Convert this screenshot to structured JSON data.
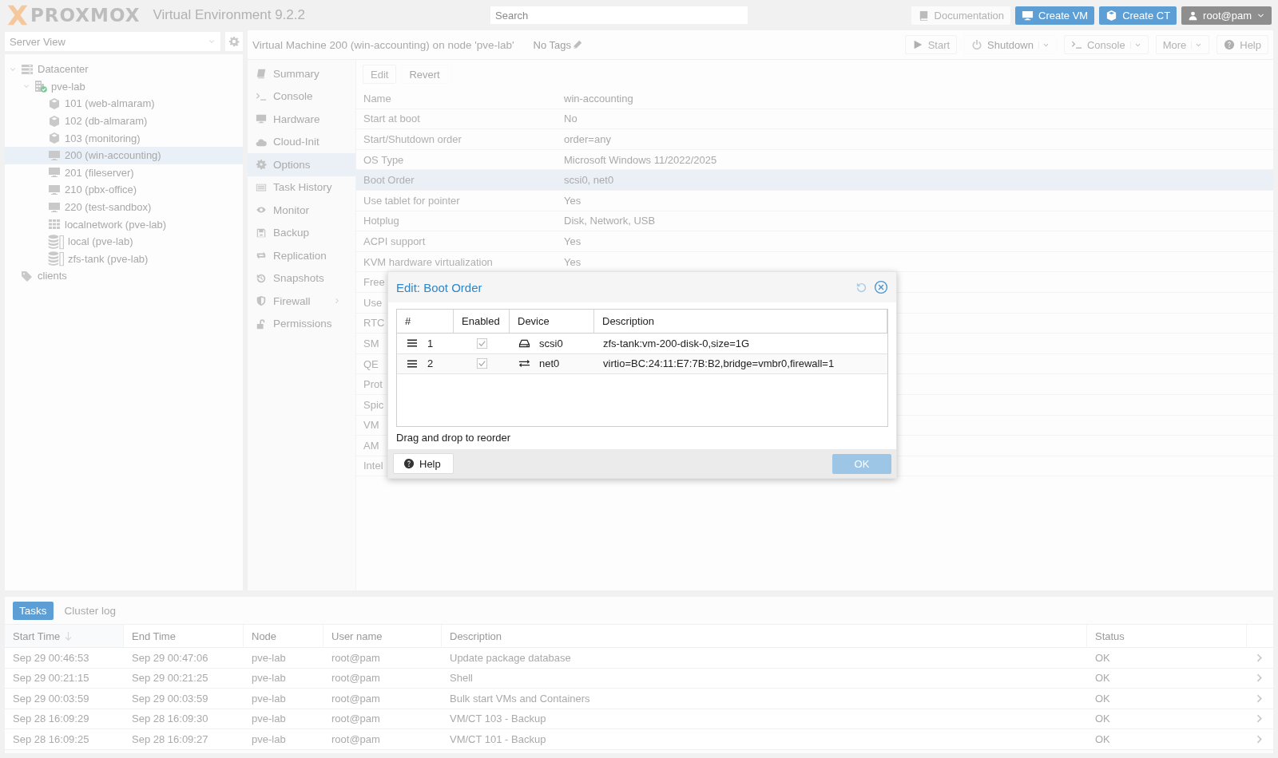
{
  "header": {
    "logo": "PROXMOX",
    "product": "Virtual Environment 9.2.2",
    "search": {
      "placeholder": "Search"
    },
    "buttons": [
      {
        "label": "Documentation",
        "kind": "doc"
      },
      {
        "label": "Create VM",
        "kind": "vm"
      },
      {
        "label": "Create CT",
        "kind": "ct"
      }
    ],
    "user": "root@pam"
  },
  "sidebar": {
    "view": "Server View",
    "tree": [
      {
        "label": "Datacenter",
        "kind": "datacenter",
        "selected": false,
        "expanded": true,
        "children": [
          {
            "label": "pve-lab",
            "kind": "node",
            "selected": false,
            "expanded": true,
            "children": [
              {
                "label": "101 (web-almaram)",
                "kind": "ct",
                "selected": false
              },
              {
                "label": "102 (db-almaram)",
                "kind": "ct",
                "selected": false
              },
              {
                "label": "103 (monitoring)",
                "kind": "ct",
                "selected": false
              },
              {
                "label": "200 (win-accounting)",
                "kind": "vm",
                "selected": true
              },
              {
                "label": "201 (fileserver)",
                "kind": "vm",
                "selected": false
              },
              {
                "label": "210 (pbx-office)",
                "kind": "vm",
                "selected": false
              },
              {
                "label": "220 (test-sandbox)",
                "kind": "vm",
                "selected": false
              },
              {
                "label": "localnetwork (pve-lab)",
                "kind": "sdn",
                "selected": false
              },
              {
                "label": "local (pve-lab)",
                "kind": "storage",
                "selected": false
              },
              {
                "label": "zfs-tank (pve-lab)",
                "kind": "storage",
                "selected": false
              }
            ]
          }
        ]
      },
      {
        "label": "clients",
        "kind": "tag",
        "selected": false
      }
    ]
  },
  "vm": {
    "title": "Virtual Machine 200 (win-accounting) on node 'pve-lab'",
    "tags": "No Tags",
    "toolbar": [
      {
        "label": "Start",
        "kind": "start",
        "disabled": false,
        "dropdown": false
      },
      {
        "label": "Shutdown",
        "kind": "shutdown",
        "disabled": true,
        "dropdown": true
      },
      {
        "label": "Console",
        "kind": "console",
        "disabled": false,
        "dropdown": true
      },
      {
        "label": "More",
        "kind": "more",
        "disabled": false,
        "dropdown": true
      },
      {
        "label": "Help",
        "kind": "help",
        "disabled": false,
        "dropdown": false
      }
    ],
    "menu": [
      {
        "label": "Summary",
        "kind": "summary",
        "selected": false,
        "expandable": false
      },
      {
        "label": "Console",
        "kind": "console",
        "selected": false,
        "expandable": false
      },
      {
        "label": "Hardware",
        "kind": "hardware",
        "selected": false,
        "expandable": false
      },
      {
        "label": "Cloud-Init",
        "kind": "cloud",
        "selected": false,
        "expandable": false
      },
      {
        "label": "Options",
        "kind": "options",
        "selected": true,
        "expandable": false
      },
      {
        "label": "Task History",
        "kind": "tasks",
        "selected": false,
        "expandable": false
      },
      {
        "label": "Monitor",
        "kind": "monitor",
        "selected": false,
        "expandable": false
      },
      {
        "label": "Backup",
        "kind": "backup",
        "selected": false,
        "expandable": false
      },
      {
        "label": "Replication",
        "kind": "replication",
        "selected": false,
        "expandable": false
      },
      {
        "label": "Snapshots",
        "kind": "snapshots",
        "selected": false,
        "expandable": false
      },
      {
        "label": "Firewall",
        "kind": "firewall",
        "selected": false,
        "expandable": true
      },
      {
        "label": "Permissions",
        "kind": "permissions",
        "selected": false,
        "expandable": false
      }
    ],
    "options": {
      "buttons": [
        {
          "label": "Edit",
          "disabled": false
        },
        {
          "label": "Revert",
          "disabled": true
        }
      ],
      "rows": [
        {
          "label": "Name",
          "value": "win-accounting",
          "selected": false
        },
        {
          "label": "Start at boot",
          "value": "No",
          "selected": false
        },
        {
          "label": "Start/Shutdown order",
          "value": "order=any",
          "selected": false
        },
        {
          "label": "OS Type",
          "value": "Microsoft Windows 11/2022/2025",
          "selected": false
        },
        {
          "label": "Boot Order",
          "value": "scsi0, net0",
          "selected": true
        },
        {
          "label": "Use tablet for pointer",
          "value": "Yes",
          "selected": false
        },
        {
          "label": "Hotplug",
          "value": "Disk, Network, USB",
          "selected": false
        },
        {
          "label": "ACPI support",
          "value": "Yes",
          "selected": false
        },
        {
          "label": "KVM hardware virtualization",
          "value": "Yes",
          "selected": false
        },
        {
          "label": "Free",
          "selected": false
        },
        {
          "label": "Use",
          "selected": false
        },
        {
          "label": "RTC",
          "selected": false
        },
        {
          "label": "SM",
          "selected": false
        },
        {
          "label": "QE",
          "selected": false
        },
        {
          "label": "Prot",
          "selected": false
        },
        {
          "label": "Spic",
          "selected": false
        },
        {
          "label": "VM",
          "selected": false
        },
        {
          "label": "AM",
          "selected": false
        },
        {
          "label": "Intel",
          "selected": false
        }
      ]
    }
  },
  "dialog": {
    "title": "Edit: Boot Order",
    "columns": [
      "#",
      "Enabled",
      "Device",
      "Description"
    ],
    "rows": [
      {
        "order": "1",
        "enabled": true,
        "kind": "disk",
        "device": "scsi0",
        "description": "zfs-tank:vm-200-disk-0,size=1G"
      },
      {
        "order": "2",
        "enabled": true,
        "kind": "net",
        "device": "net0",
        "description": "virtio=BC:24:11:E7:7B:B2,bridge=vmbr0,firewall=1"
      }
    ],
    "hint": "Drag and drop to reorder",
    "help": "Help",
    "ok": "OK"
  },
  "tasks": {
    "tabs": [
      {
        "label": "Tasks",
        "selected": true
      },
      {
        "label": "Cluster log",
        "selected": false
      }
    ],
    "columns": [
      {
        "label": "Start Time",
        "sorted": true
      },
      {
        "label": "End Time",
        "sorted": false
      },
      {
        "label": "Node",
        "sorted": false
      },
      {
        "label": "User name",
        "sorted": false
      },
      {
        "label": "Description",
        "sorted": false
      },
      {
        "label": "Status",
        "sorted": false
      }
    ],
    "rows": [
      [
        "Sep 29 00:46:53",
        "Sep 29 00:47:06",
        "pve-lab",
        "root@pam",
        "Update package database",
        "OK"
      ],
      [
        "Sep 29 00:21:15",
        "Sep 29 00:21:25",
        "pve-lab",
        "root@pam",
        "Shell",
        "OK"
      ],
      [
        "Sep 29 00:03:59",
        "Sep 29 00:03:59",
        "pve-lab",
        "root@pam",
        "Bulk start VMs and Containers",
        "OK"
      ],
      [
        "Sep 28 16:09:29",
        "Sep 28 16:09:30",
        "pve-lab",
        "root@pam",
        "VM/CT 103 - Backup",
        "OK"
      ],
      [
        "Sep 28 16:09:25",
        "Sep 28 16:09:27",
        "pve-lab",
        "root@pam",
        "VM/CT 101 - Backup",
        "OK"
      ]
    ]
  }
}
